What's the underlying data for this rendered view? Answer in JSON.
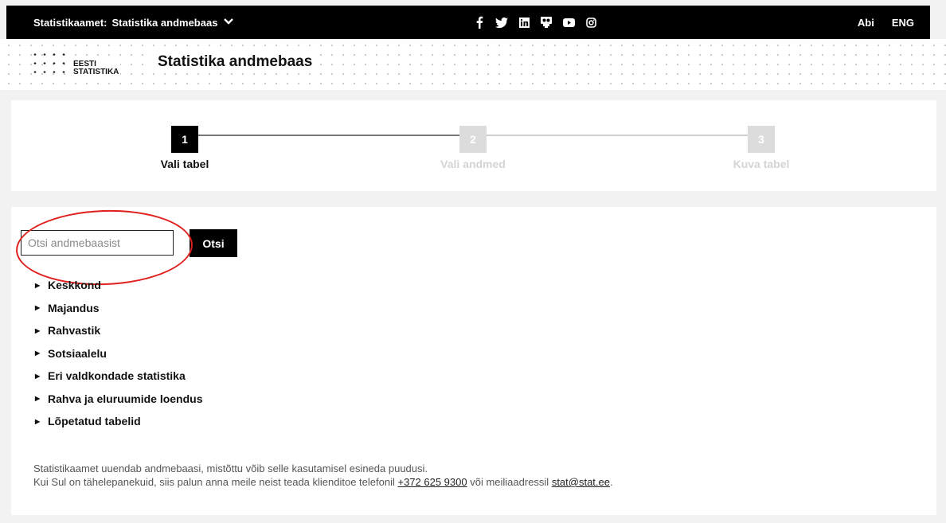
{
  "topbar": {
    "org": "Statistikaamet:",
    "site": "Statistika andmebaas",
    "social": [
      {
        "icon": "facebook-icon"
      },
      {
        "icon": "twitter-icon"
      },
      {
        "icon": "linkedin-icon"
      },
      {
        "icon": "flickr-icon"
      },
      {
        "icon": "youtube-icon"
      },
      {
        "icon": "instagram-icon"
      }
    ],
    "help": "Abi",
    "lang": "ENG"
  },
  "header": {
    "logo_line1": "EESTI",
    "logo_line2": "STATISTIKA",
    "title": "Statistika andmebaas"
  },
  "steps": [
    {
      "number": "1",
      "label": "Vali tabel",
      "active": true
    },
    {
      "number": "2",
      "label": "Vali andmed",
      "active": false
    },
    {
      "number": "3",
      "label": "Kuva tabel",
      "active": false
    }
  ],
  "search": {
    "placeholder": "Otsi andmebaasist",
    "button": "Otsi"
  },
  "tree": [
    "Keskkond",
    "Majandus",
    "Rahvastik",
    "Sotsiaalelu",
    "Eri valdkondade statistika",
    "Rahva ja eluruumide loendus",
    "Lõpetatud tabelid"
  ],
  "notice": {
    "line1": "Statistikaamet uuendab andmebaasi, mistõttu võib selle kasutamisel esineda puudusi.",
    "line2_prefix": "Kui Sul on tähelepanekuid, siis palun anna meile neist teada klienditoe telefonil ",
    "phone": "+372 625 9300",
    "line2_middle": " või meiliaadressil ",
    "email": "stat@stat.ee",
    "line2_suffix": "."
  },
  "colors": {
    "active_step": "#000000",
    "inactive_step": "#dcdcdc",
    "highlight_ellipse": "#e0201c"
  }
}
